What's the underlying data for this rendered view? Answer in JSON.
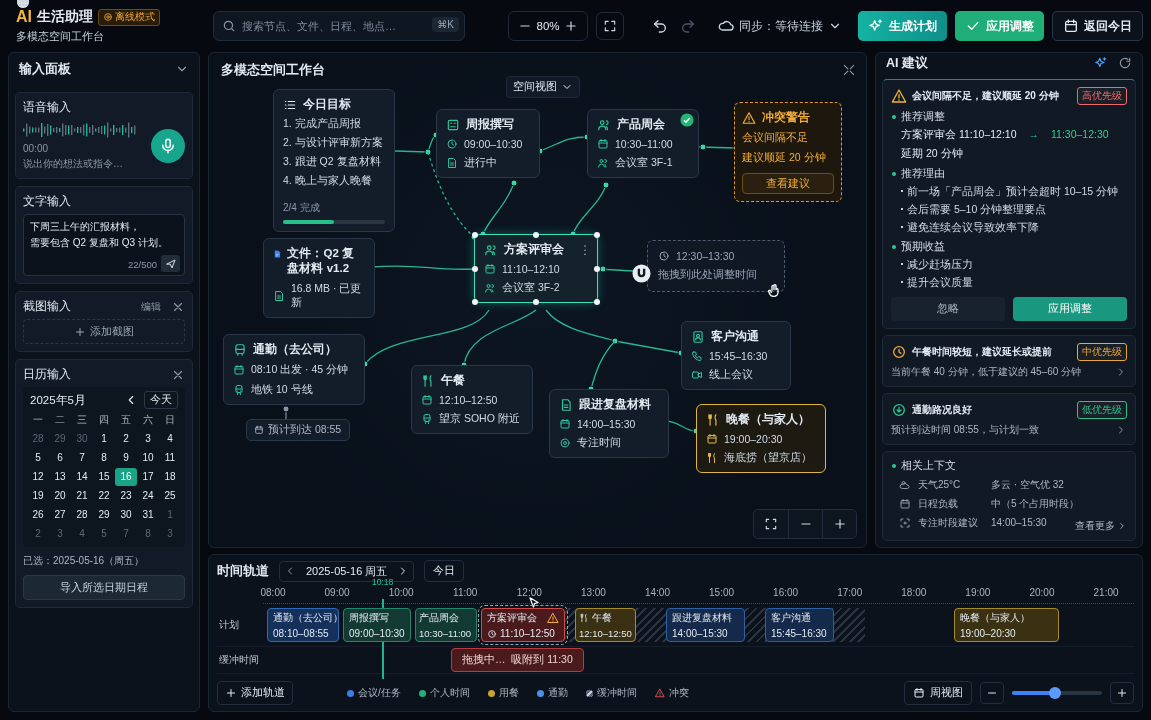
{
  "app": {
    "logo_mark": "AI",
    "name": "生活助理",
    "mode_badge": "离线模式",
    "subtitle": "多模态空间工作台"
  },
  "toolbar": {
    "search": {
      "placeholder": "搜索节点、文件、日程、地点…",
      "shortcut": "⌘K"
    },
    "zoom": "80%",
    "redo_disabled": true,
    "sync": "同步：等待连接",
    "buttons": [
      {
        "label": "生成计划",
        "kind": "generate"
      },
      {
        "label": "应用调整",
        "kind": "apply"
      },
      {
        "label": "返回今日",
        "kind": "today"
      }
    ]
  },
  "input_panel": {
    "title": "输入面板",
    "voice": {
      "title": "语音输入",
      "time": "00:00",
      "hint": "说出你的想法或指令…"
    },
    "text": {
      "title": "文字输入",
      "value_lines": [
        "下周三上午的汇报材料，",
        "需要包含 Q2 复盘和 Q3 计划。"
      ],
      "counter": "22/500"
    },
    "screenshot": {
      "title": "截图输入",
      "edit": "编辑",
      "add": "添加截图"
    },
    "calendar": {
      "title": "日历输入",
      "month": "2025年5月",
      "today": "今天",
      "weekdays": [
        "一",
        "二",
        "三",
        "四",
        "五",
        "六",
        "日"
      ],
      "days": [
        {
          "label": "28",
          "other": true,
          "selected": false
        },
        {
          "label": "29",
          "other": true,
          "selected": false
        },
        {
          "label": "30",
          "other": true,
          "selected": false
        },
        {
          "label": "1",
          "other": false,
          "selected": false
        },
        {
          "label": "2",
          "other": false,
          "selected": false
        },
        {
          "label": "3",
          "other": false,
          "selected": false
        },
        {
          "label": "4",
          "other": false,
          "selected": false
        },
        {
          "label": "5",
          "other": false,
          "selected": false
        },
        {
          "label": "6",
          "other": false,
          "selected": false
        },
        {
          "label": "7",
          "other": false,
          "selected": false
        },
        {
          "label": "8",
          "other": false,
          "selected": false
        },
        {
          "label": "9",
          "other": false,
          "selected": false
        },
        {
          "label": "10",
          "other": false,
          "selected": false
        },
        {
          "label": "11",
          "other": false,
          "selected": false
        },
        {
          "label": "12",
          "other": false,
          "selected": false
        },
        {
          "label": "13",
          "other": false,
          "selected": false
        },
        {
          "label": "14",
          "other": false,
          "selected": false
        },
        {
          "label": "15",
          "other": false,
          "selected": false
        },
        {
          "label": "16",
          "other": false,
          "selected": true
        },
        {
          "label": "17",
          "other": false,
          "selected": false
        },
        {
          "label": "18",
          "other": false,
          "selected": false
        },
        {
          "label": "19",
          "other": false,
          "selected": false
        },
        {
          "label": "20",
          "other": false,
          "selected": false
        },
        {
          "label": "21",
          "other": false,
          "selected": false
        },
        {
          "label": "22",
          "other": false,
          "selected": false
        },
        {
          "label": "23",
          "other": false,
          "selected": false
        },
        {
          "label": "24",
          "other": false,
          "selected": false
        },
        {
          "label": "25",
          "other": false,
          "selected": false
        },
        {
          "label": "26",
          "other": false,
          "selected": false
        },
        {
          "label": "27",
          "other": false,
          "selected": false
        },
        {
          "label": "28",
          "other": false,
          "selected": false
        },
        {
          "label": "29",
          "other": false,
          "selected": false
        },
        {
          "label": "30",
          "other": false,
          "selected": false
        },
        {
          "label": "31",
          "other": false,
          "selected": false
        },
        {
          "label": "1",
          "other": true,
          "selected": false
        },
        {
          "label": "2",
          "other": true,
          "selected": false
        },
        {
          "label": "3",
          "other": true,
          "selected": false
        },
        {
          "label": "4",
          "other": true,
          "selected": false
        },
        {
          "label": "5",
          "other": true,
          "selected": false
        },
        {
          "label": "7",
          "other": true,
          "selected": false
        },
        {
          "label": "8",
          "other": true,
          "selected": false
        },
        {
          "label": "3",
          "other": true,
          "selected": false
        }
      ],
      "selected_text": "已选：2025-05-16（周五）",
      "import": "导入所选日期日程"
    }
  },
  "canvas": {
    "title": "多模态空间工作台",
    "view": "空间视图",
    "nodes": [
      {
        "kind": "goal",
        "title": "今日目标",
        "items": [
          "1. 完成产品周报",
          "2. 与设计评审新方案",
          "3. 跟进 Q2 复盘材料",
          "4. 晚上与家人晚餐"
        ],
        "progress_text": "2/4 完成",
        "level": 0.5
      },
      {
        "kind": "card",
        "title": "周报撰写",
        "rows": [
          "09:00–10:30",
          "进行中"
        ],
        "selected": false,
        "done": false,
        "highlighted": false
      },
      {
        "kind": "card",
        "title": "产品周会",
        "rows": [
          "10:30–11:00",
          "会议室 3F-1"
        ],
        "selected": false,
        "done": true,
        "highlighted": false
      },
      {
        "kind": "warning",
        "title": "冲突警告",
        "lines": [
          "会议间隔不足",
          "建议顺延 20 分钟"
        ],
        "action": "查看建议"
      },
      {
        "kind": "file",
        "title": "文件：Q2 复盘材料 v1.2",
        "meta": "16.8 MB · 已更新"
      },
      {
        "kind": "card",
        "title": "方案评审会",
        "rows": [
          "11:10–12:10",
          "会议室 3F-2"
        ],
        "selected": true,
        "done": false,
        "highlighted": false
      },
      {
        "kind": "drop",
        "time": "12:30–13:30",
        "hint": "拖拽到此处调整时间"
      },
      {
        "kind": "card",
        "title": "通勤（去公司）",
        "rows": [
          "08:10 出发 · 45 分钟",
          "地铁 10 号线"
        ],
        "selected": false,
        "done": false,
        "highlighted": false
      },
      {
        "kind": "chip",
        "text": "预计到达 08:55"
      },
      {
        "kind": "card",
        "title": "午餐",
        "rows": [
          "12:10–12:50",
          "望京 SOHO 附近"
        ],
        "selected": false,
        "done": false,
        "highlighted": false
      },
      {
        "kind": "card",
        "title": "跟进复盘材料",
        "rows": [
          "14:00–15:30",
          "专注时间"
        ],
        "selected": false,
        "done": false,
        "highlighted": false
      },
      {
        "kind": "card",
        "title": "客户沟通",
        "rows": [
          "15:45–16:30",
          "线上会议"
        ],
        "selected": false,
        "done": false,
        "highlighted": false
      },
      {
        "kind": "card",
        "title": "晚餐（与家人）",
        "rows": [
          "19:00–20:30",
          "海底捞（望京店）"
        ],
        "selected": false,
        "done": false,
        "highlighted": true
      }
    ]
  },
  "ai": {
    "title": "AI 建议",
    "primary": {
      "title": "会议间隔不足，建议顺延 20 分钟",
      "priority": "高优先级",
      "color": "#ee6a6a",
      "sections": [
        {
          "kind": "change",
          "heading": "推荐调整",
          "from": "方案评审会 11:10–12:10",
          "arrow": "→",
          "to": "11:30–12:30",
          "note": "延期 20 分钟"
        },
        {
          "kind": "bullets",
          "heading": "推荐理由",
          "items": [
            "前一场「产品周会」预计会超时 10–15 分钟",
            "会后需要 5–10 分钟整理要点",
            "避免连续会议导致效率下降"
          ]
        },
        {
          "kind": "bullets",
          "heading": "预期收益",
          "items": [
            "减少赶场压力",
            "提升会议质量"
          ]
        }
      ],
      "actions": [
        {
          "label": "忽略",
          "kind": "ignore"
        },
        {
          "label": "应用调整",
          "kind": "apply"
        }
      ]
    },
    "cards": [
      {
        "title": "午餐时间较短，建议延长或提前",
        "priority": "中优先级",
        "color": "#e8a93a",
        "desc": "当前午餐 40 分钟，低于建议的 45–60 分钟"
      },
      {
        "title": "通勤路况良好",
        "priority": "低优先级",
        "color": "#2fc28c",
        "desc": "预计到达时间 08:55，与计划一致"
      }
    ],
    "context": {
      "title": "相关上下文",
      "rows": [
        {
          "label": "天气25°C",
          "value": "多云 · 空气优 32"
        },
        {
          "label": "日程负载",
          "value": "中（5 个占用时段）"
        },
        {
          "label": "专注时段建议",
          "value": "14:00–15:30"
        }
      ],
      "more": "查看更多"
    }
  },
  "timeline": {
    "title": "时间轨道",
    "date": "2025-05-16 周五",
    "today": "今日",
    "hours": [
      "08:00",
      "09:00",
      "10:00",
      "11:00",
      "12:00",
      "13:00",
      "14:00",
      "15:00",
      "16:00",
      "17:00",
      "18:00",
      "19:00",
      "20:00",
      "21:00"
    ],
    "now": "10:18",
    "lanes": [
      "计划",
      "缓冲时间"
    ],
    "blocks": [
      {
        "label": "通勤（去公司）",
        "time": "08:10–08:55",
        "kind": "commute"
      },
      {
        "label": "周报撰写",
        "time": "09:00–10:30",
        "kind": "personal"
      },
      {
        "label": "产品周会",
        "time": "10:30–11:00",
        "kind": "personal"
      },
      {
        "label": "方案评审会",
        "time": "11:10–12:50",
        "kind": "conflict"
      },
      {
        "label": "午餐",
        "time": "12:10–12:50",
        "kind": "meal"
      },
      {
        "label": "跟进复盘材料",
        "time": "14:00–15:30",
        "kind": "meeting"
      },
      {
        "label": "客户沟通",
        "time": "15:45–16:30",
        "kind": "meeting"
      },
      {
        "label": "晚餐（与家人）",
        "time": "19:00–20:30",
        "kind": "meal"
      }
    ],
    "drag_tip": "拖拽中…  吸附到 11:30",
    "add_lane": "添加轨道",
    "legend": [
      {
        "label": "会议/任务",
        "kind": "meeting"
      },
      {
        "label": "个人时间",
        "kind": "personal"
      },
      {
        "label": "用餐",
        "kind": "meal"
      },
      {
        "label": "通勤",
        "kind": "commute"
      },
      {
        "label": "缓冲时间",
        "kind": "buffer"
      },
      {
        "label": "冲突",
        "kind": "conflict"
      }
    ],
    "week_view": "周视图",
    "zoom": {
      "level": 0.48
    }
  }
}
